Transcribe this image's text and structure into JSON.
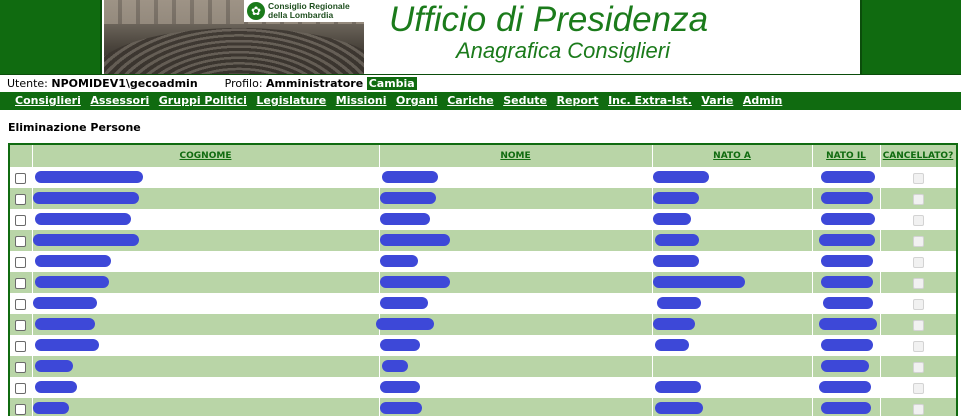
{
  "banner": {
    "logo_text": "Consiglio Regionale della Lombardia",
    "title": "Ufficio di Presidenza",
    "subtitle": "Anagrafica Consiglieri"
  },
  "userbar": {
    "user_label": "Utente:",
    "user_value": "NPOMIDEV1\\gecoadmin",
    "profile_label": "Profilo:",
    "profile_value": "Amministratore",
    "change_label": "Cambia"
  },
  "menu": [
    "Consiglieri",
    "Assessori",
    "Gruppi Politici",
    "Legislature",
    "Missioni",
    "Organi",
    "Cariche",
    "Sedute",
    "Report",
    "Inc. Extra-Ist.",
    "Varie",
    "Admin"
  ],
  "page": {
    "heading": "Eliminazione Persone"
  },
  "table": {
    "columns": [
      "COGNOME",
      "NOME",
      "NATO A",
      "NATO IL",
      "CANCELLATO?"
    ],
    "rows": 12,
    "redacted": true
  },
  "colors": {
    "brand_green": "#106b10",
    "row_alt": "#b9d5a7",
    "redaction": "#3d48d8"
  }
}
